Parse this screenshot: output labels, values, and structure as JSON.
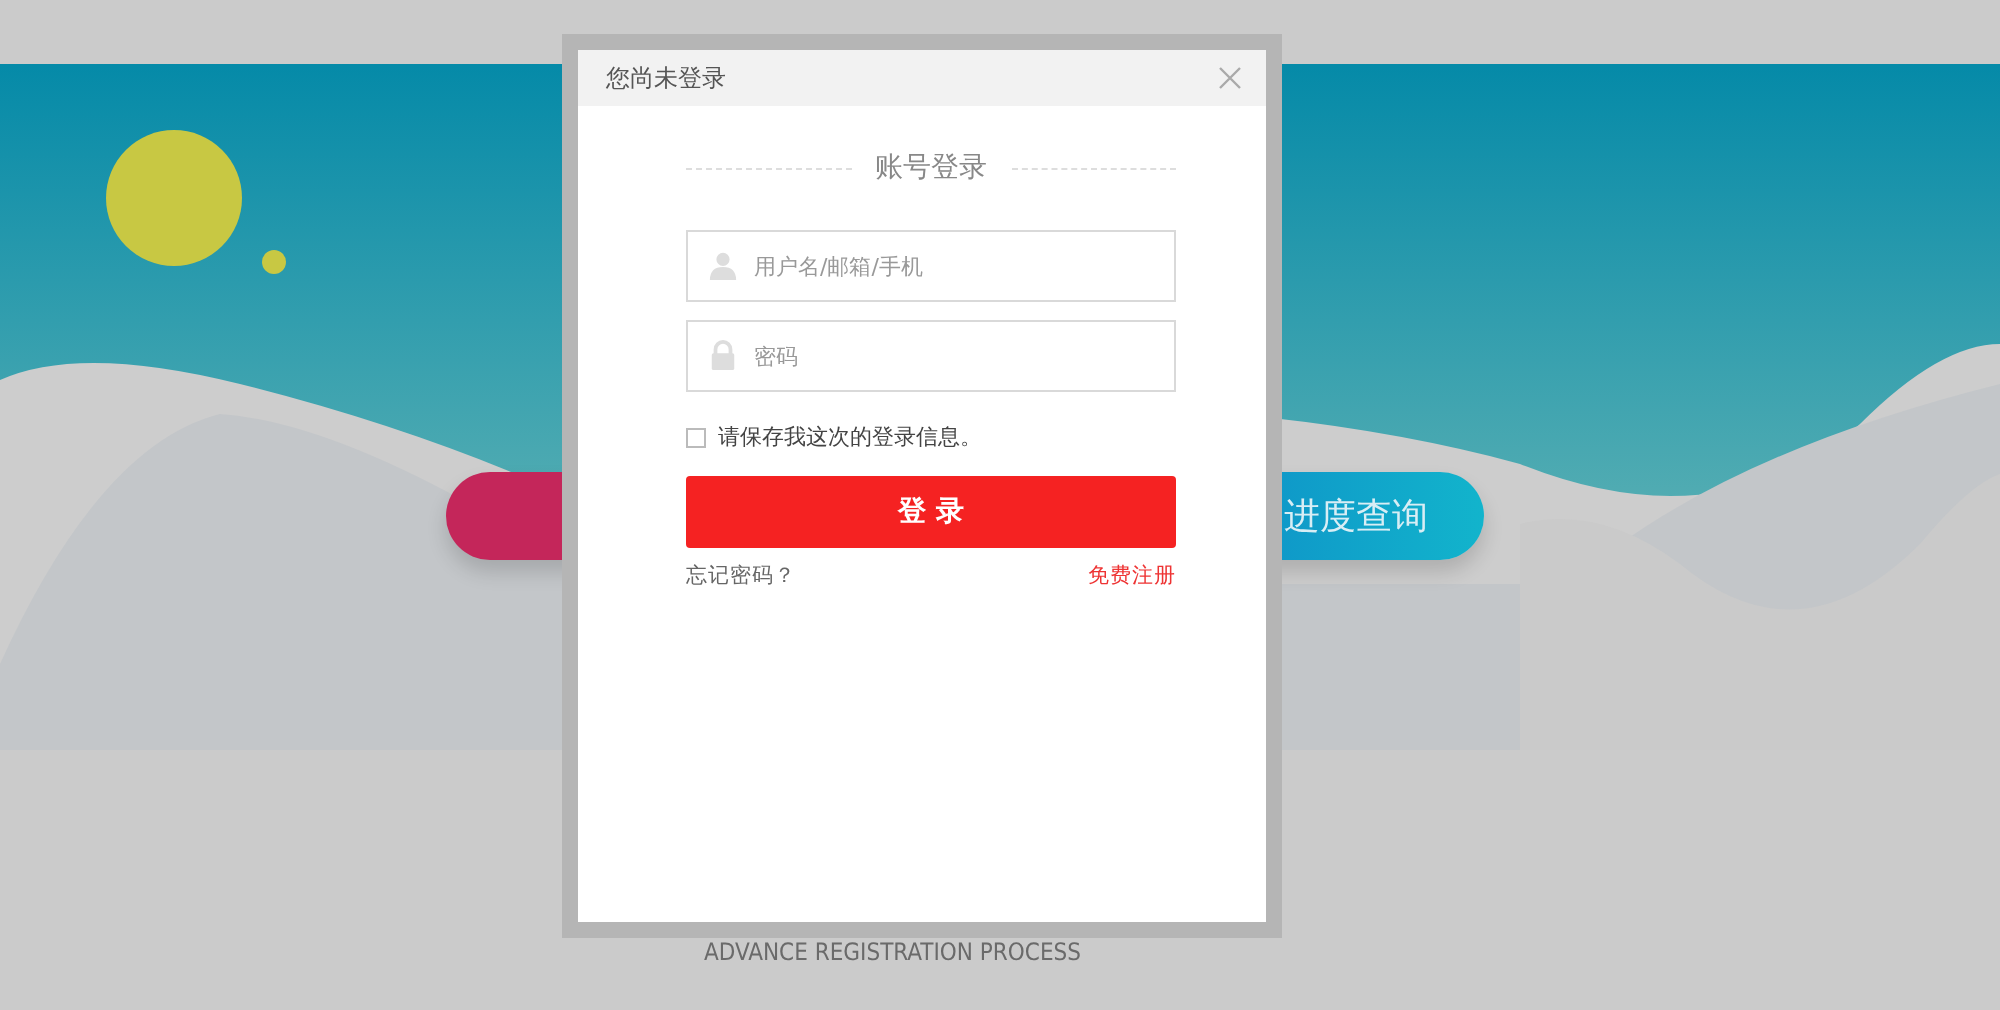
{
  "background": {
    "query_button": "进度查询",
    "caption": "ADVANCE REGISTRATION PROCESS"
  },
  "modal": {
    "title": "您尚未登录",
    "heading": "账号登录",
    "username": {
      "placeholder": "用户名/邮箱/手机"
    },
    "password": {
      "placeholder": "密码"
    },
    "remember": {
      "label": "请保存我这次的登录信息。",
      "checked": false
    },
    "login_button": "登 录",
    "forgot_link": "忘记密码？",
    "register_link": "免费注册"
  }
}
